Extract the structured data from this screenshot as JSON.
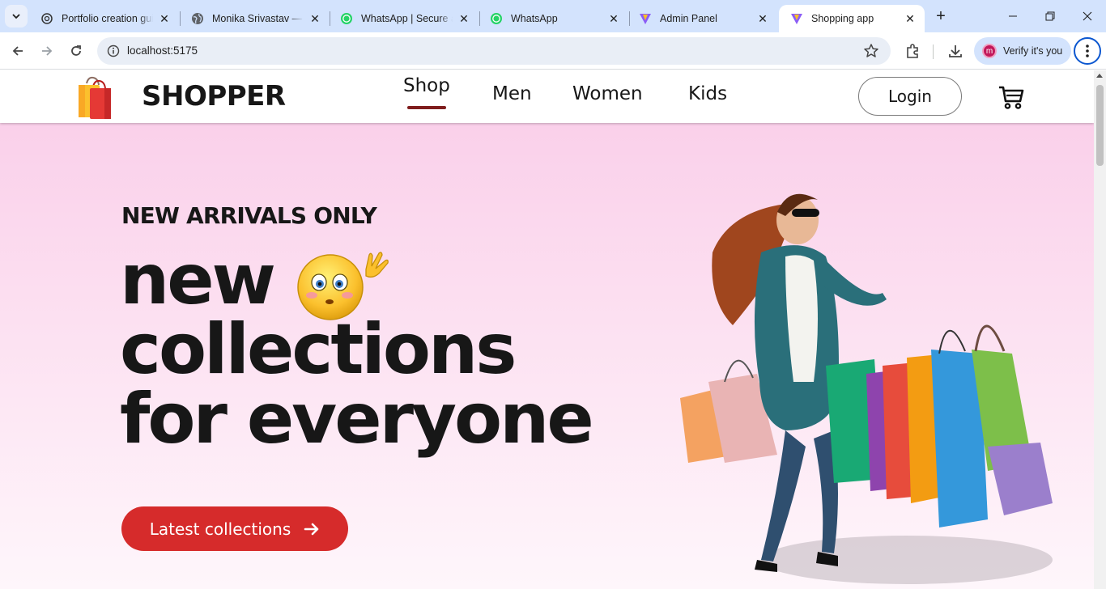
{
  "browser": {
    "tabs": [
      {
        "title": "Portfolio creation gui",
        "favicon": "openai-icon"
      },
      {
        "title": "Monika Srivastav — M",
        "favicon": "globe-icon"
      },
      {
        "title": "WhatsApp | Secure ar",
        "favicon": "whatsapp-icon"
      },
      {
        "title": "WhatsApp",
        "favicon": "whatsapp-icon"
      },
      {
        "title": "Admin Panel",
        "favicon": "vite-icon"
      },
      {
        "title": "Shopping app",
        "favicon": "vite-icon",
        "active": true
      }
    ],
    "url": "localhost:5175",
    "profile_label": "Verify it's you",
    "profile_initial": "m",
    "accent": "#0b57d0"
  },
  "nav": {
    "brand": "SHOPPER",
    "menu": [
      "Shop",
      "Men",
      "Women",
      "Kids"
    ],
    "active_menu": "Shop",
    "login_label": "Login"
  },
  "hero": {
    "eyebrow": "NEW ARRIVALS ONLY",
    "line1": "new",
    "line2": "collections",
    "line3": "for everyone",
    "cta_label": "Latest collections",
    "cta_color": "#d62b2b",
    "background": "#fad0ea"
  }
}
